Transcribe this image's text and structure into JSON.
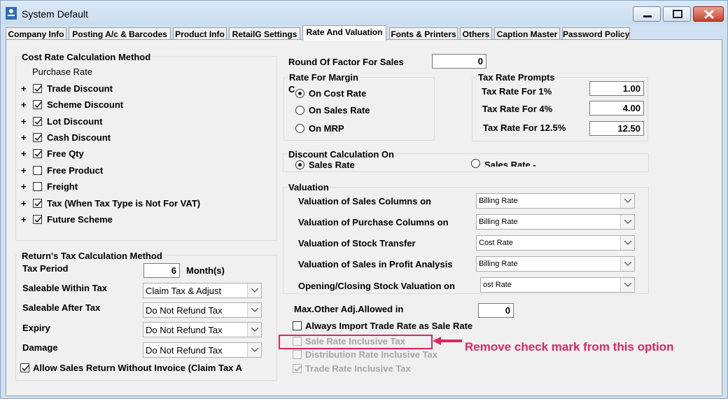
{
  "window": {
    "title": "System Default"
  },
  "tabs": [
    {
      "label": "Company Info"
    },
    {
      "label": "Posting A/c & Barcodes"
    },
    {
      "label": "Product Info"
    },
    {
      "label": "RetailG Settings"
    },
    {
      "label": "Rate And Valuation"
    },
    {
      "label": "Fonts & Printers"
    },
    {
      "label": "Others"
    },
    {
      "label": "Caption Master"
    },
    {
      "label": "Password Policy"
    }
  ],
  "cost_rate": {
    "title": "Cost Rate Calculation Method",
    "subtitle": "Purchase Rate",
    "items": [
      {
        "label": "Trade Discount",
        "checked": true
      },
      {
        "label": "Scheme  Discount",
        "checked": true
      },
      {
        "label": "Lot Discount",
        "checked": true
      },
      {
        "label": "Cash Discount",
        "checked": true
      },
      {
        "label": "Free Qty",
        "checked": true
      },
      {
        "label": "Free Product",
        "checked": false
      },
      {
        "label": "Freight",
        "checked": false
      },
      {
        "label": "Tax (When Tax Type is Not For VAT)",
        "checked": true
      },
      {
        "label": "Future Scheme",
        "checked": true
      }
    ]
  },
  "returns": {
    "title": "Return's Tax Calculation Method",
    "tax_period_label": "Tax Period",
    "tax_period_value": "6",
    "tax_period_unit": "Month(s)",
    "rows": [
      {
        "label": "Saleable  Within Tax",
        "value": "Claim Tax & Adjust"
      },
      {
        "label": "Saleable  After Tax",
        "value": "Do Not Refund Tax"
      },
      {
        "label": "Expiry",
        "value": "Do Not Refund Tax"
      },
      {
        "label": "Damage",
        "value": "Do Not Refund Tax"
      }
    ],
    "allow_without_invoice": "Allow Sales Return Without Invoice (Claim Tax A"
  },
  "round_factor": {
    "label": "Round Of Factor For Sales",
    "value": "0"
  },
  "margin": {
    "title": "Rate For Margin",
    "clipped_text": "C",
    "options": [
      {
        "label": "On Cost Rate",
        "selected": true
      },
      {
        "label": "On Sales Rate",
        "selected": false
      },
      {
        "label": "On MRP",
        "selected": false
      }
    ]
  },
  "tax_prompts": {
    "title": "Tax Rate Prompts",
    "rows": [
      {
        "label": "Tax Rate For 1%",
        "value": "1.00"
      },
      {
        "label": "Tax Rate For 4%",
        "value": "4.00"
      },
      {
        "label": "Tax Rate For 12.5%",
        "value": "12.50"
      }
    ]
  },
  "discount_calc": {
    "title": "Discount Calculation On",
    "opt1": "Sales Rate",
    "opt2": "Sales Rate -"
  },
  "valuation": {
    "title": "Valuation",
    "rows": [
      {
        "label": "Valuation of Sales Columns on",
        "value": "Billing Rate"
      },
      {
        "label": "Valuation of Purchase Columns on",
        "value": "Billing Rate"
      },
      {
        "label": "Valuation of Stock Transfer",
        "value": "Cost Rate"
      },
      {
        "label": "Valuation of Sales in Profit Analysis",
        "value": "Billing Rate"
      },
      {
        "label": "Opening/Closing Stock Valuation on",
        "value": "ost Rate"
      }
    ]
  },
  "max_adj": {
    "label": "Max.Other Adj.Allowed in",
    "value": "0"
  },
  "options": {
    "always_import": "Always Import Trade Rate as Sale Rate",
    "sale_inclusive": "Sale Rate Inclusive Tax",
    "distribution_inclusive": "Distribution Rate Inclusive Tax",
    "trade_inclusive": "Trade Rate Inclusive Tax"
  },
  "annotation": {
    "text": "Remove check mark from this option",
    "color": "#e0245e"
  },
  "icons": [
    "app-icon",
    "minimize-icon",
    "maximize-icon",
    "close-icon",
    "checkmark-icon",
    "dropdown-arrow-icon",
    "annotation-arrow-icon"
  ]
}
